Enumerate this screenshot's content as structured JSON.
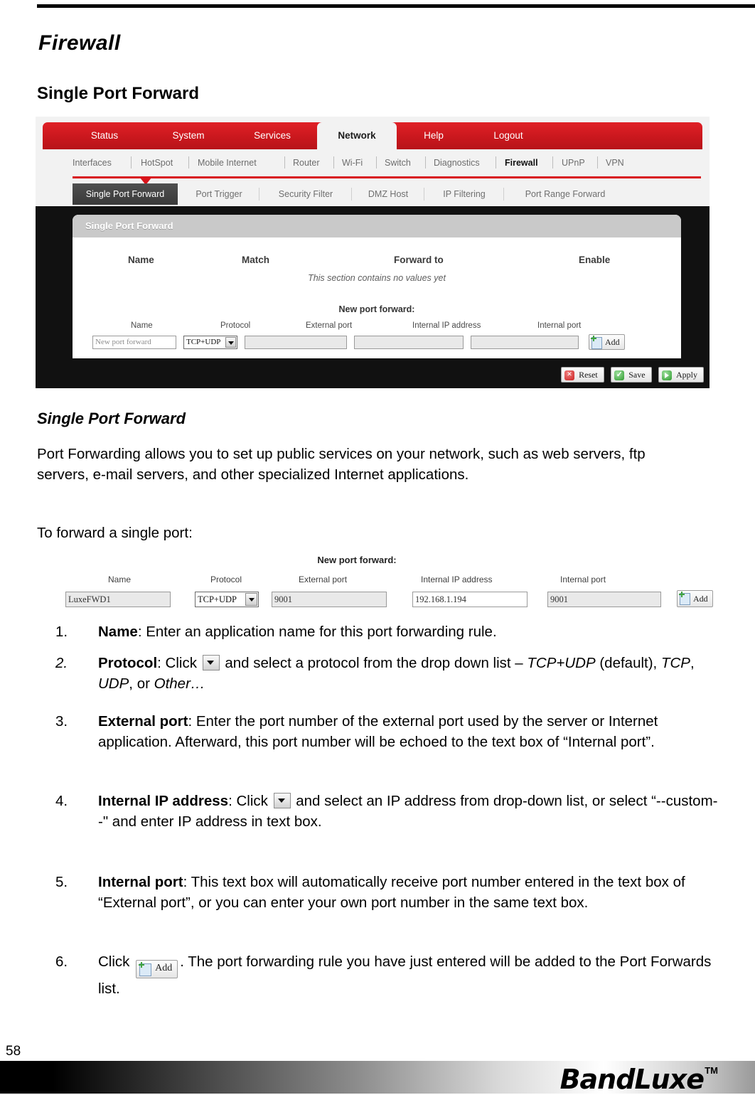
{
  "document": {
    "heading": "Firewall",
    "subheading": "Single Port Forward",
    "page_number": "58",
    "brand": "BandLuxe",
    "trademark": "TM"
  },
  "router_ui": {
    "main_nav": [
      {
        "label": "Status",
        "active": false
      },
      {
        "label": "System",
        "active": false
      },
      {
        "label": "Services",
        "active": false
      },
      {
        "label": "Network",
        "active": true
      },
      {
        "label": "Help",
        "active": false
      },
      {
        "label": "Logout",
        "active": false
      }
    ],
    "sub_nav": [
      {
        "label": "Interfaces",
        "active": false
      },
      {
        "label": "HotSpot",
        "active": false
      },
      {
        "label": "Mobile Internet",
        "active": false
      },
      {
        "label": "Router",
        "active": false
      },
      {
        "label": "Wi-Fi",
        "active": false
      },
      {
        "label": "Switch",
        "active": false
      },
      {
        "label": "Diagnostics",
        "active": false
      },
      {
        "label": "Firewall",
        "active": true
      },
      {
        "label": "UPnP",
        "active": false
      },
      {
        "label": "VPN",
        "active": false
      }
    ],
    "section_tabs": [
      {
        "label": "Single Port Forward",
        "active": true
      },
      {
        "label": "Port Trigger",
        "active": false
      },
      {
        "label": "Security Filter",
        "active": false
      },
      {
        "label": "DMZ Host",
        "active": false
      },
      {
        "label": "IP Filtering",
        "active": false
      },
      {
        "label": "Port Range Forward",
        "active": false
      }
    ],
    "panel": {
      "title": "Single Port Forward",
      "table_headers": [
        "Name",
        "Match",
        "Forward to",
        "Enable"
      ],
      "empty_message": "This section contains no values yet",
      "new_forward_title": "New port forward:",
      "field_labels": [
        "Name",
        "Protocol",
        "External port",
        "Internal IP address",
        "Internal port"
      ],
      "name_placeholder": "New port forward",
      "protocol_value": "TCP+UDP",
      "external_port_value": "",
      "internal_ip_value": "",
      "internal_port_value": "",
      "add_label": "Add"
    },
    "footer_buttons": [
      {
        "label": "Reset",
        "icon": "red-x-icon"
      },
      {
        "label": "Save",
        "icon": "green-check-icon"
      },
      {
        "label": "Apply",
        "icon": "green-play-icon"
      }
    ]
  },
  "body": {
    "section_title": "Single Port Forward",
    "paragraph_1": "Port Forwarding allows you to set up public services on your network, such as web servers, ftp servers, e-mail servers, and other specialized Internet applications.",
    "paragraph_2": "To forward a single port:"
  },
  "example_form": {
    "title": "New port forward:",
    "labels": [
      "Name",
      "Protocol",
      "External port",
      "Internal IP address",
      "Internal port"
    ],
    "name": "LuxeFWD1",
    "protocol": "TCP+UDP",
    "external_port": "9001",
    "internal_ip": "192.168.1.194",
    "internal_port": "9001",
    "add_label": "Add"
  },
  "steps": [
    {
      "number": "1.",
      "term": "Name",
      "text": ": Enter an application name for this port forwarding rule."
    },
    {
      "number": "2.",
      "term": "Protocol",
      "text_before": ": Click ",
      "text_after": " and select a protocol from the drop down list – ",
      "option_1": "TCP+UDP",
      "option_1_suffix": " (default), ",
      "option_2": "TCP",
      "option_2_suffix": ", ",
      "option_3": "UDP",
      "option_3_suffix": ", or ",
      "option_4": "Other…"
    },
    {
      "number": "3.",
      "term": "External port",
      "text": ": Enter the port number of the external port used by the server or Internet application. Afterward, this port number will be echoed to the text box of “Internal port”."
    },
    {
      "number": "4.",
      "term": "Internal IP address",
      "text_before": ": Click ",
      "text_after": " and select an IP address from drop-down list, or select “--custom--\" and enter IP address in text box."
    },
    {
      "number": "5.",
      "term": "Internal port",
      "text": ": This text box will automatically receive port number entered in the text box of “External port”, or you can enter your own port number in the same text box."
    },
    {
      "number": "6.",
      "text_before": "Click ",
      "button_label": "Add",
      "text_after": ". The port forwarding rule you have just entered will be added to the Port Forwards list."
    }
  ]
}
